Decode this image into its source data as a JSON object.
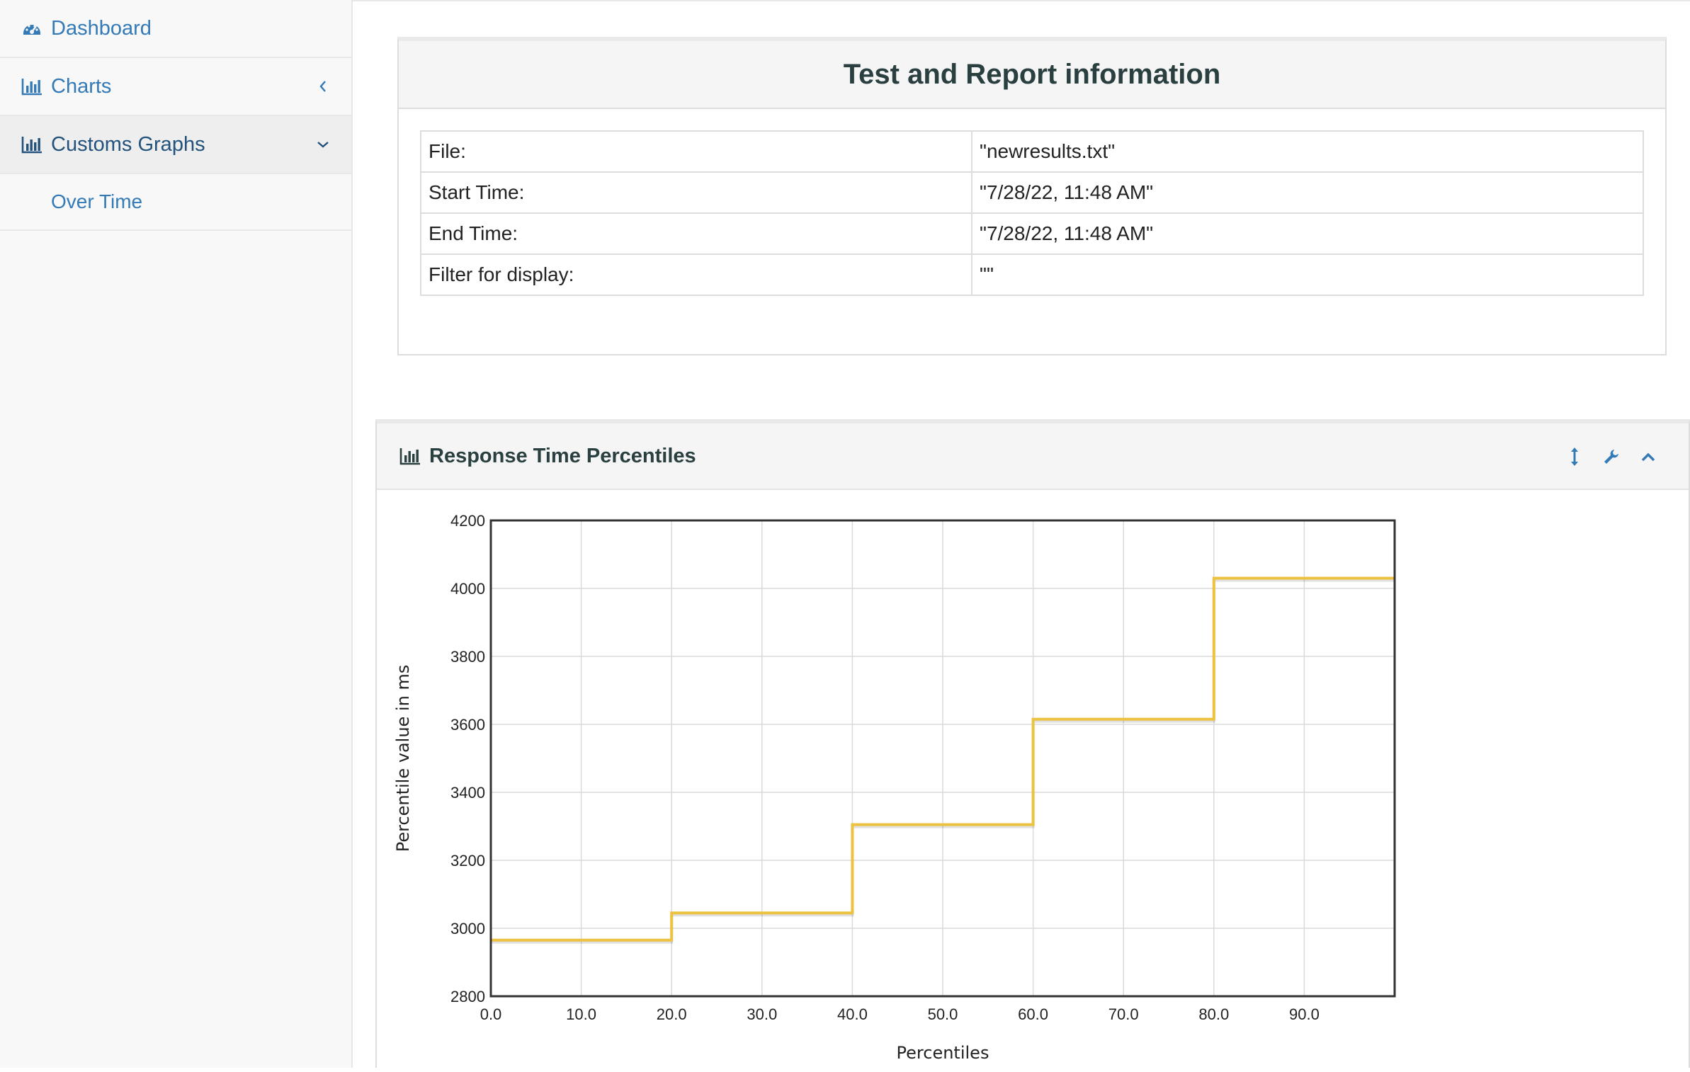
{
  "sidebar": {
    "items": [
      {
        "label": "Dashboard",
        "icon": "dashboard-icon"
      },
      {
        "label": "Charts",
        "icon": "bar-chart-icon"
      },
      {
        "label": "Customs Graphs",
        "icon": "bar-chart-icon"
      }
    ],
    "subitems": [
      {
        "label": "Over Time"
      }
    ]
  },
  "info": {
    "title": "Test and Report information",
    "rows": [
      {
        "key": "File:",
        "value": "\"newresults.txt\""
      },
      {
        "key": "Start Time:",
        "value": "\"7/28/22, 11:48 AM\""
      },
      {
        "key": "End Time:",
        "value": "\"7/28/22, 11:48 AM\""
      },
      {
        "key": "Filter for display:",
        "value": "\"\""
      }
    ]
  },
  "chart_panel": {
    "title": "Response Time Percentiles",
    "tools": [
      "resize-icon",
      "wrench-icon",
      "chevron-up-icon"
    ]
  },
  "colors": {
    "link": "#337ab7",
    "series": "#edc240",
    "border": "#dddddd"
  },
  "chart_data": {
    "type": "line",
    "step": true,
    "xlabel": "Percentiles",
    "ylabel": "Percentile value in ms",
    "xlim": [
      0,
      100
    ],
    "ylim": [
      2800,
      4200
    ],
    "xticks": [
      "0.0",
      "10.0",
      "20.0",
      "30.0",
      "40.0",
      "50.0",
      "60.0",
      "70.0",
      "80.0",
      "90.0"
    ],
    "yticks": [
      "2800",
      "3000",
      "3200",
      "3400",
      "3600",
      "4000",
      "4200",
      "3800"
    ],
    "grid": true,
    "series": [
      {
        "x": [
          0,
          20,
          20,
          40,
          40,
          60,
          60,
          80,
          80,
          100
        ],
        "y": [
          2965,
          2965,
          3045,
          3045,
          3305,
          3305,
          3615,
          3615,
          4030,
          4030
        ]
      }
    ]
  }
}
